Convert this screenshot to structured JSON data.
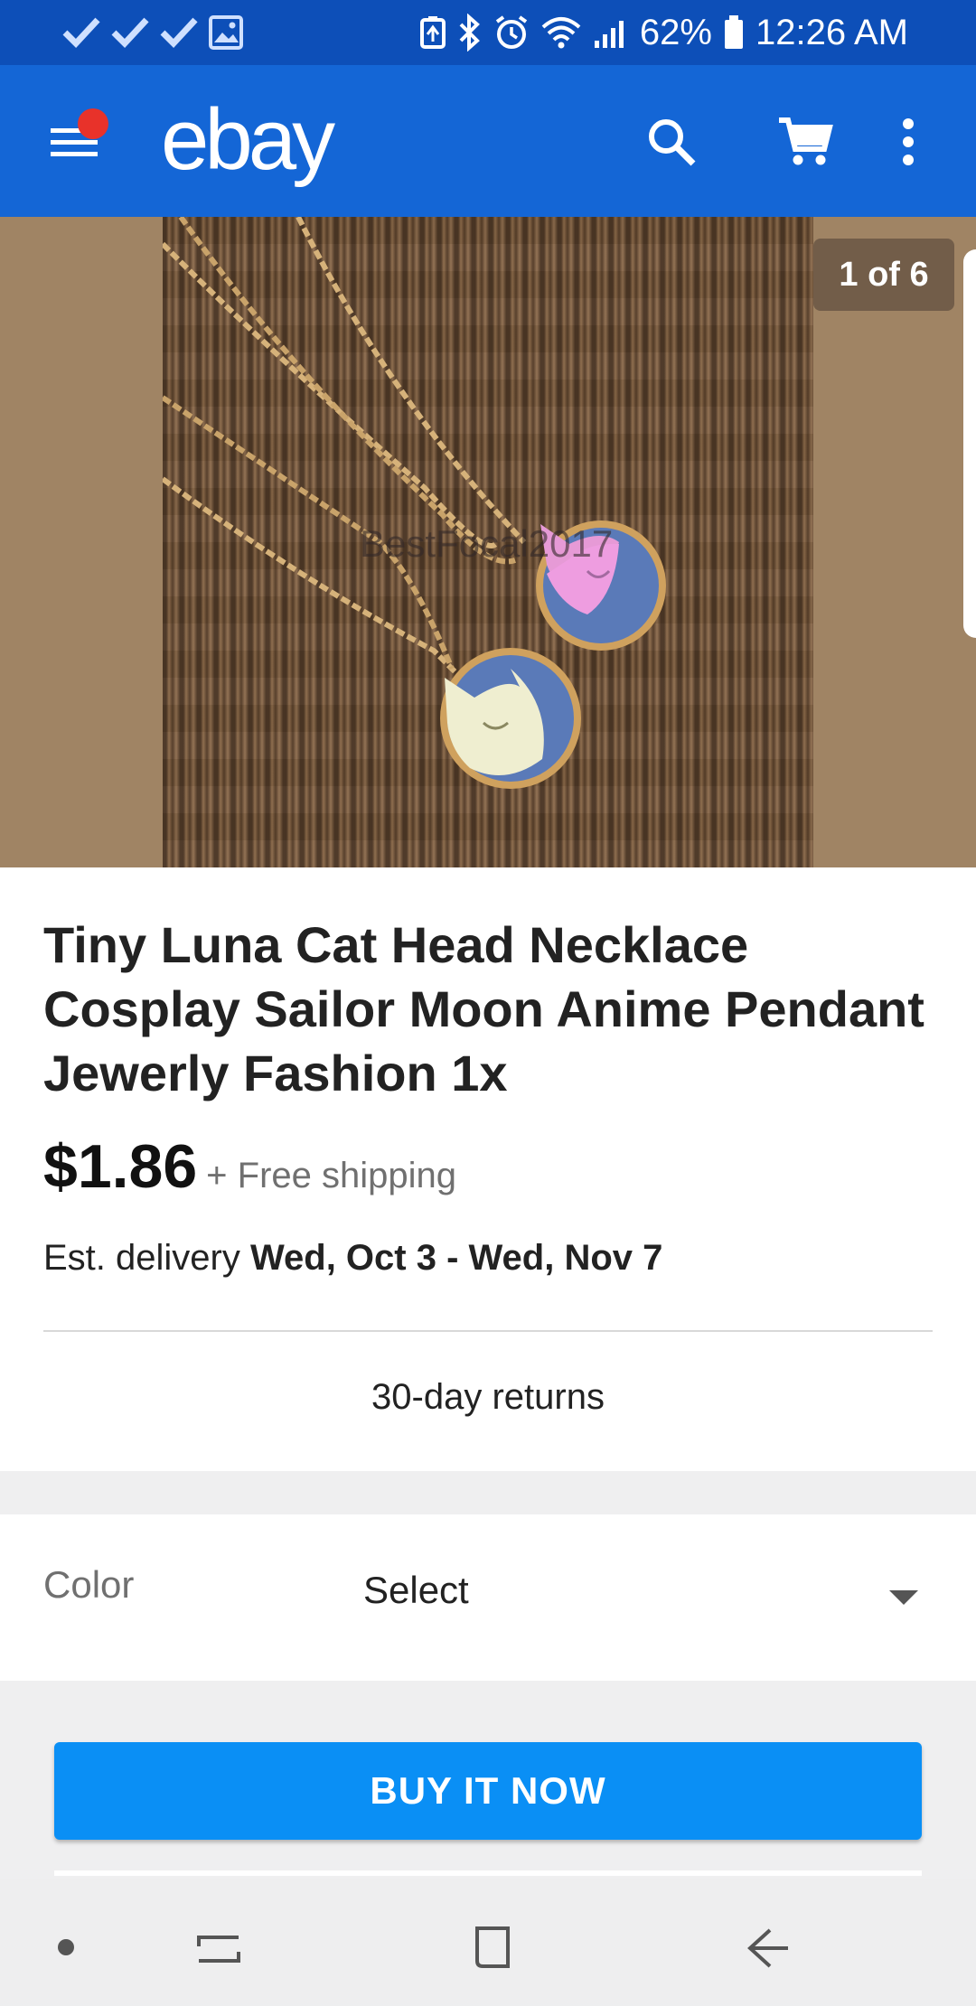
{
  "status_bar": {
    "battery": "62%",
    "time": "12:26 AM"
  },
  "app_bar": {
    "logo": "ebay"
  },
  "gallery": {
    "counter": "1 of 6",
    "watermark": "BestFocal2017"
  },
  "listing": {
    "title": "Tiny Luna Cat Head Necklace Cosplay Sailor Moon Anime Pendant Jewerly Fashion 1x",
    "price": "$1.86",
    "shipping": "+ Free shipping",
    "delivery_label": "Est. delivery",
    "delivery_dates": "Wed, Oct 3 - Wed, Nov 7",
    "returns": "30-day returns"
  },
  "variation": {
    "label": "Color",
    "value": "Select"
  },
  "actions": {
    "buy_now": "BUY IT NOW"
  },
  "colors": {
    "status_bar": "#0d4fb8",
    "app_bar": "#1466d6",
    "buy_button": "#0a8ff5",
    "notification_dot": "#e8322a"
  }
}
